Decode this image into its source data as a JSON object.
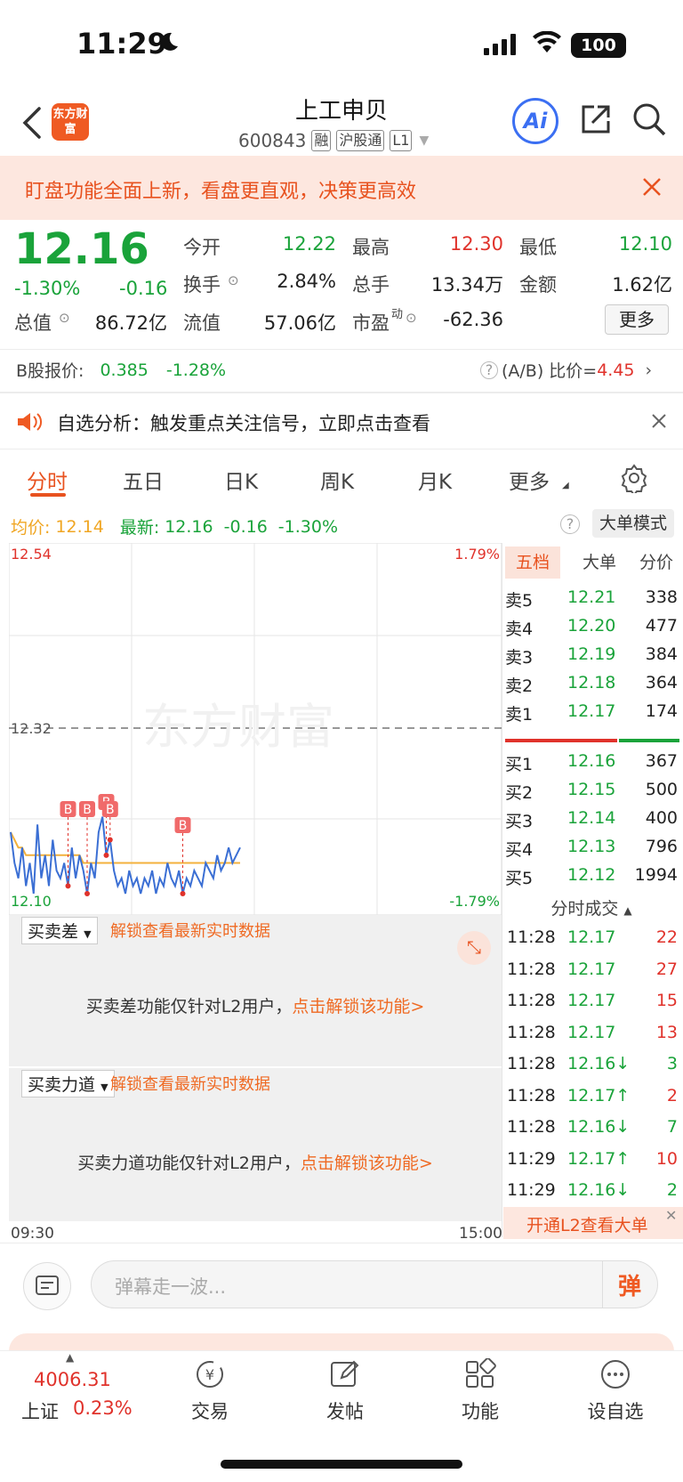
{
  "status": {
    "time": "11:29",
    "battery": "100"
  },
  "header": {
    "logo_text": "东方财富",
    "name": "上工申贝",
    "code": "600843",
    "tags": [
      "融",
      "沪股通",
      "L1"
    ],
    "ai_label": "Ai"
  },
  "banner": {
    "text": "盯盘功能全面上新，看盘更直观，决策更高效"
  },
  "quote": {
    "price": "12.16",
    "pct": "-1.30%",
    "change": "-0.16",
    "fields": [
      {
        "label": "今开",
        "value": "12.22"
      },
      {
        "label": "最高",
        "value": "12.30"
      },
      {
        "label": "最低",
        "value": "12.10"
      },
      {
        "label": "换手",
        "value": "2.84%"
      },
      {
        "label": "总手",
        "value": "13.34万"
      },
      {
        "label": "金额",
        "value": "1.62亿"
      },
      {
        "label": "总值",
        "value": "86.72亿"
      },
      {
        "label": "流值",
        "value": "57.06亿"
      },
      {
        "label": "市盈",
        "value": "-62.36"
      }
    ],
    "pe_sup": "动",
    "more": "更多"
  },
  "bshare": {
    "label": "B股报价:",
    "price": "0.385",
    "pct": "-1.28%",
    "ratio_label": "(A/B) 比价=",
    "ratio": "4.45"
  },
  "notice": {
    "text": "自选分析：触发重点关注信号，立即点击查看"
  },
  "tabs": [
    "分时",
    "五日",
    "日K",
    "周K",
    "月K",
    "更多"
  ],
  "avg": {
    "avg_label": "均价:",
    "avg": "12.14",
    "latest_label": "最新:",
    "latest": "12.16",
    "change": "-0.16",
    "pct": "-1.30%"
  },
  "bigorder": "大单模式",
  "chart_data": {
    "type": "line",
    "y_high": "12.54",
    "y_mid": "12.32",
    "y_low": "12.10",
    "pct_high": "1.79%",
    "pct_low": "-1.79%",
    "x_start": "09:30",
    "x_end": "15:00",
    "watermark": "东方财富",
    "series": [
      {
        "values": [
          12.18,
          12.14,
          12.12,
          12.16,
          12.11,
          12.14,
          12.1,
          12.19,
          12.12,
          12.15,
          12.11,
          12.17,
          12.13,
          12.12,
          12.14,
          12.11,
          12.16,
          12.12,
          12.15,
          12.13,
          12.1,
          12.14,
          12.12,
          12.18,
          12.2,
          12.15,
          12.17,
          12.13,
          12.11,
          12.12,
          12.1,
          12.13,
          12.11,
          12.12,
          12.1,
          12.12,
          12.11,
          12.13,
          12.1,
          12.12,
          12.11,
          12.14,
          12.12,
          12.11,
          12.13,
          12.1,
          12.12,
          12.11,
          12.13,
          12.12,
          12.11,
          12.14,
          12.13,
          12.12,
          12.15,
          12.13,
          12.14,
          12.16,
          12.14,
          12.15,
          12.16
        ]
      },
      {
        "values": [
          12.18,
          12.17,
          12.16,
          12.16,
          12.15,
          12.15,
          12.15,
          12.15,
          12.15,
          12.15,
          12.15,
          12.15,
          12.15,
          12.15,
          12.15,
          12.15,
          12.15,
          12.15,
          12.15,
          12.14,
          12.14,
          12.14,
          12.14,
          12.14,
          12.14,
          12.14,
          12.14,
          12.14,
          12.14,
          12.14,
          12.14,
          12.14,
          12.14,
          12.14,
          12.14,
          12.14,
          12.14,
          12.14,
          12.14,
          12.14,
          12.14,
          12.14,
          12.14,
          12.14,
          12.14,
          12.14,
          12.14,
          12.14,
          12.14,
          12.14,
          12.14,
          12.14,
          12.14,
          12.14,
          12.14,
          12.14,
          12.14,
          12.14,
          12.14,
          12.14,
          12.14
        ]
      }
    ],
    "markers": [
      "B",
      "B",
      "B",
      "B",
      "B"
    ]
  },
  "book": {
    "tabs": [
      "五档",
      "大单",
      "分价"
    ],
    "asks": [
      {
        "label": "卖5",
        "price": "12.21",
        "vol": "338"
      },
      {
        "label": "卖4",
        "price": "12.20",
        "vol": "477"
      },
      {
        "label": "卖3",
        "price": "12.19",
        "vol": "384"
      },
      {
        "label": "卖2",
        "price": "12.18",
        "vol": "364"
      },
      {
        "label": "卖1",
        "price": "12.17",
        "vol": "174"
      }
    ],
    "bids": [
      {
        "label": "买1",
        "price": "12.16",
        "vol": "367"
      },
      {
        "label": "买2",
        "price": "12.15",
        "vol": "500"
      },
      {
        "label": "买3",
        "price": "12.14",
        "vol": "400"
      },
      {
        "label": "买4",
        "price": "12.13",
        "vol": "796"
      },
      {
        "label": "买5",
        "price": "12.12",
        "vol": "1994"
      }
    ],
    "trades_title": "分时成交",
    "trades": [
      {
        "time": "11:28",
        "price": "12.17",
        "vol": "22"
      },
      {
        "time": "11:28",
        "price": "12.17",
        "vol": "27"
      },
      {
        "time": "11:28",
        "price": "12.17",
        "vol": "15"
      },
      {
        "time": "11:28",
        "price": "12.17",
        "vol": "13"
      },
      {
        "time": "11:28",
        "price": "12.16↓",
        "vol": "3"
      },
      {
        "time": "11:28",
        "price": "12.17↑",
        "vol": "2"
      },
      {
        "time": "11:28",
        "price": "12.16↓",
        "vol": "7"
      },
      {
        "time": "11:29",
        "price": "12.17↑",
        "vol": "10"
      },
      {
        "time": "11:29",
        "price": "12.16↓",
        "vol": "2"
      }
    ],
    "l2_promo": "开通L2查看大单"
  },
  "panels": [
    {
      "title": "买卖差",
      "link": "解锁查看最新实时数据",
      "msg": "买卖差功能仅针对L2用户，",
      "cta": "点击解锁该功能>"
    },
    {
      "title": "买卖力道",
      "link": "解锁查看最新实时数据",
      "msg": "买卖力道功能仅针对L2用户，",
      "cta": "点击解锁该功能>"
    }
  ],
  "comment": {
    "placeholder": "弹幕走一波...",
    "send": "弹"
  },
  "nav": {
    "index_value": "4006.31",
    "index_name": "上证",
    "index_pct": "0.23%",
    "items": [
      "交易",
      "发帖",
      "功能",
      "设自选"
    ]
  }
}
